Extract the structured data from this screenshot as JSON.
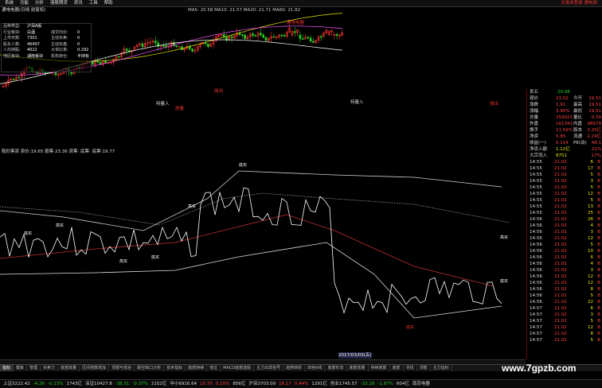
{
  "menu": {
    "items": [
      "系统",
      "功能",
      "分析",
      "港股期货",
      "资讯",
      "工具",
      "帮助"
    ],
    "right": "交易未登录   通电商"
  },
  "main": {
    "title": "通电电器(日线 前复权)",
    "indicator_line": "MA5: 20.58  MA10: 21.57  MA20: 21.71  MA60: 21.82",
    "info": [
      {
        "k": "品种类型:",
        "v": "沪深A股"
      },
      {
        "k": "行业板块:",
        "v": "白酒",
        "k2": "成交均价:",
        "v2": "0"
      },
      {
        "k": "上市天数:",
        "v": "7301",
        "k2": "主动买卖:",
        "v2": "0"
      },
      {
        "k": "股东人数:",
        "v": "46497",
        "k2": "主动买盘:",
        "v2": "0"
      },
      {
        "k": "人均持股:",
        "v": "4022",
        "k2": "大单比率:",
        "v2": "0.292"
      },
      {
        "k": "地区板块:",
        "v": "湖南板块",
        "k2": "机构持仓:",
        "v2": "半持有"
      }
    ],
    "annot": [
      "特量入",
      "放量",
      "抛出",
      "特量入",
      "抛出"
    ],
    "right_label": "通电电器"
  },
  "sub": {
    "indicator": "隐形筹资  资价:19.65  股筹:23.36  资筹:  底筹:  底筹:19.77",
    "labels": [
      "高买",
      "底买",
      "底买",
      "高买",
      "底买",
      "底买",
      "高买",
      "高买",
      "底买"
    ],
    "date_label": "2017/03/03(五)"
  },
  "panel": {
    "sell5": {
      "label": "卖五",
      "price": "20.98"
    },
    "rows": [
      {
        "a": "现价",
        "b": "21.02",
        "c": "今开",
        "d": "19.51"
      },
      {
        "a": "涨跌",
        "b": "1.91",
        "c": "最高",
        "d": "19.51"
      },
      {
        "a": "涨幅",
        "b": "3.90%",
        "c": "最低",
        "d": "19.51"
      },
      {
        "a": "总量",
        "b": "259921",
        "c": "量比",
        "d": "0.39"
      },
      {
        "a": "外盘",
        "b": "161342",
        "c": "内盘",
        "d": "98579"
      },
      {
        "a": "换手",
        "b": "11.59%",
        "c": "股本",
        "d": "3.25亿"
      },
      {
        "a": "净资",
        "b": "5.85",
        "c": "流通",
        "d": "2.24亿"
      },
      {
        "a": "收益(一)",
        "b": "0.114",
        "c": "PE(动)",
        "d": "48.1"
      },
      {
        "a": "净流入额",
        "b": "1.12亿",
        "c": "",
        "d": "21%"
      },
      {
        "a": "大宗流入",
        "b": "8751",
        "c": "",
        "d": "17%"
      }
    ],
    "ticks": [
      {
        "t": "14:55",
        "p": "21.02",
        "v": "6"
      },
      {
        "t": "14:55",
        "p": "21.02",
        "v": "17"
      },
      {
        "t": "14:55",
        "p": "21.02",
        "v": "5"
      },
      {
        "t": "14:55",
        "p": "21.02",
        "v": "3"
      },
      {
        "t": "14:55",
        "p": "21.02",
        "v": "5"
      },
      {
        "t": "14:55",
        "p": "21.02",
        "v": "12"
      },
      {
        "t": "14:55",
        "p": "21.02",
        "v": "5"
      },
      {
        "t": "14:55",
        "p": "21.02",
        "v": "13"
      },
      {
        "t": "14:55",
        "p": "21.02",
        "v": "25"
      },
      {
        "t": "14:56",
        "p": "21.02",
        "v": "26"
      },
      {
        "t": "14:56",
        "p": "21.02",
        "v": "4"
      },
      {
        "t": "14:56",
        "p": "21.02",
        "v": "3"
      },
      {
        "t": "14:56",
        "p": "21.02",
        "v": "12"
      },
      {
        "t": "14:56",
        "p": "21.02",
        "v": "5"
      },
      {
        "t": "14:56",
        "p": "21.02",
        "v": "10"
      },
      {
        "t": "14:56",
        "p": "21.02",
        "v": "6"
      },
      {
        "t": "14:56",
        "p": "21.02",
        "v": "4"
      },
      {
        "t": "14:56",
        "p": "21.02",
        "v": "3"
      },
      {
        "t": "14:56",
        "p": "21.02",
        "v": "12"
      },
      {
        "t": "14:56",
        "p": "21.02",
        "v": "12"
      },
      {
        "t": "14:56",
        "p": "21.02",
        "v": "8"
      },
      {
        "t": "14:56",
        "p": "21.02",
        "v": "5"
      },
      {
        "t": "14:56",
        "p": "21.02",
        "v": "22"
      },
      {
        "t": "14:57",
        "p": "21.02",
        "v": "6"
      },
      {
        "t": "14:57",
        "p": "21.02",
        "v": "3"
      },
      {
        "t": "14:57",
        "p": "21.02",
        "v": "5"
      },
      {
        "t": "14:57",
        "p": "21.02",
        "v": "12"
      },
      {
        "t": "14:57",
        "p": "21.02",
        "v": "8"
      },
      {
        "t": "14:57",
        "p": "21.02",
        "v": "5"
      }
    ]
  },
  "tabs": [
    "指标",
    "模板",
    "管理",
    "买卖力",
    "底部放量",
    "区间倍数增加",
    "顶部与低谷",
    "跳空缺口分析",
    "技术指标",
    "底部持续",
    "低位",
    "MACD底部选股",
    "主力出现信号",
    "趋势转折",
    "四色K线",
    "底部形态",
    "底部放量",
    "持续底部",
    "底部",
    "寻找",
    "顶部",
    "主力指标"
  ],
  "status": [
    {
      "t": "上证3222.42",
      "c": "wht"
    },
    {
      "t": "-4.26",
      "c": "grn"
    },
    {
      "t": "-0.13%",
      "c": "grn"
    },
    {
      "t": "1743亿",
      "c": "wht"
    },
    {
      "t": "深证10427.8",
      "c": "wht"
    },
    {
      "t": "-38.31",
      "c": "grn"
    },
    {
      "t": "-0.37%",
      "c": "grn"
    },
    {
      "t": "2152亿",
      "c": "wht"
    },
    {
      "t": "中小6916.64",
      "c": "wht"
    },
    {
      "t": "10.70",
      "c": "red"
    },
    {
      "t": "0.15%",
      "c": "red"
    },
    {
      "t": "856亿",
      "c": "wht"
    },
    {
      "t": "沪深3703.09",
      "c": "wht"
    },
    {
      "t": "16.17",
      "c": "red"
    },
    {
      "t": "0.44%",
      "c": "red"
    },
    {
      "t": "1291亿",
      "c": "wht"
    },
    {
      "t": "创业1745.57",
      "c": "wht"
    },
    {
      "t": "-33.29",
      "c": "grn"
    },
    {
      "t": "-1.87%",
      "c": "grn"
    },
    {
      "t": "604亿",
      "c": "wht"
    },
    {
      "t": "南京电器",
      "c": "wht"
    }
  ],
  "watermark": "www.7gpzb.com",
  "colors": {
    "up": "#ff3333",
    "down": "#22cc22",
    "bg": "#000000",
    "accent": "#e6e600"
  }
}
